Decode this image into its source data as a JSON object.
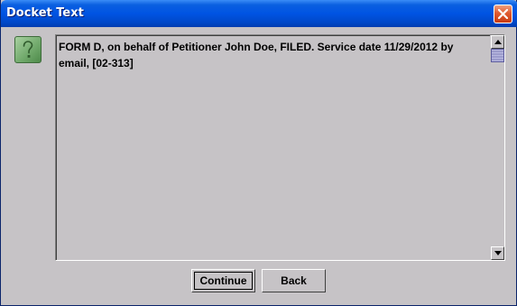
{
  "window": {
    "title": "Docket Text",
    "close_icon": "close-icon"
  },
  "dialog": {
    "icon": "help-question-icon",
    "docket_text": "FORM D, on behalf of Petitioner John Doe, FILED. Service date 11/29/2012 by email, [02-313]"
  },
  "buttons": {
    "continue_label": "Continue",
    "back_label": "Back"
  },
  "colors": {
    "titlebar": "#0054e3",
    "background": "#c6c3c6",
    "close_button": "#e05a30"
  }
}
